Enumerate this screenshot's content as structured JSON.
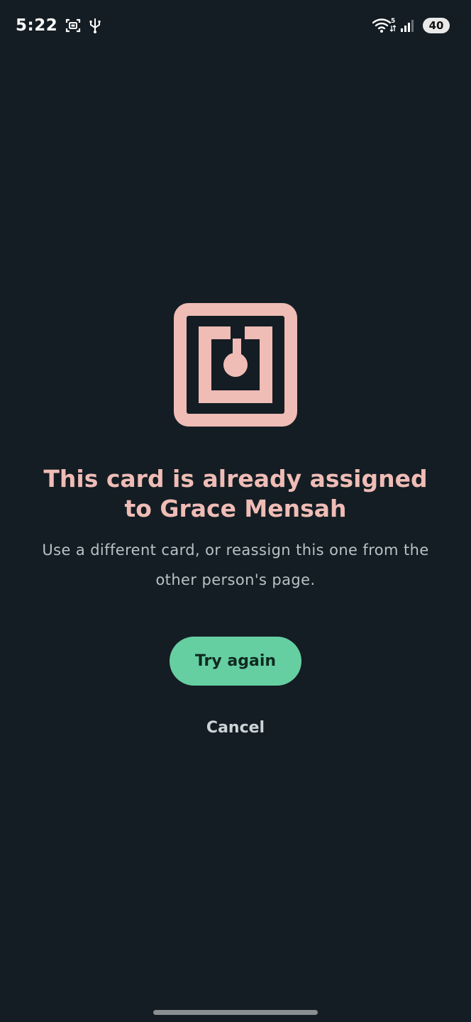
{
  "status_bar": {
    "time": "5:22",
    "network_label": "5",
    "battery": "40",
    "icons": [
      "screenshot-icon",
      "usb-icon",
      "wifi-icon",
      "signal-icon",
      "battery-icon"
    ]
  },
  "dialog": {
    "icon": "nfc-card-icon",
    "title": "This card is already assigned to Grace Mensah",
    "description": "Use a different card, or reassign this one from the other person's page.",
    "primary_label": "Try again",
    "secondary_label": "Cancel"
  },
  "colors": {
    "background": "#141d23",
    "accent_pink": "#efbcb6",
    "primary_button": "#66cfa2",
    "muted_text": "#b8c1c6"
  }
}
